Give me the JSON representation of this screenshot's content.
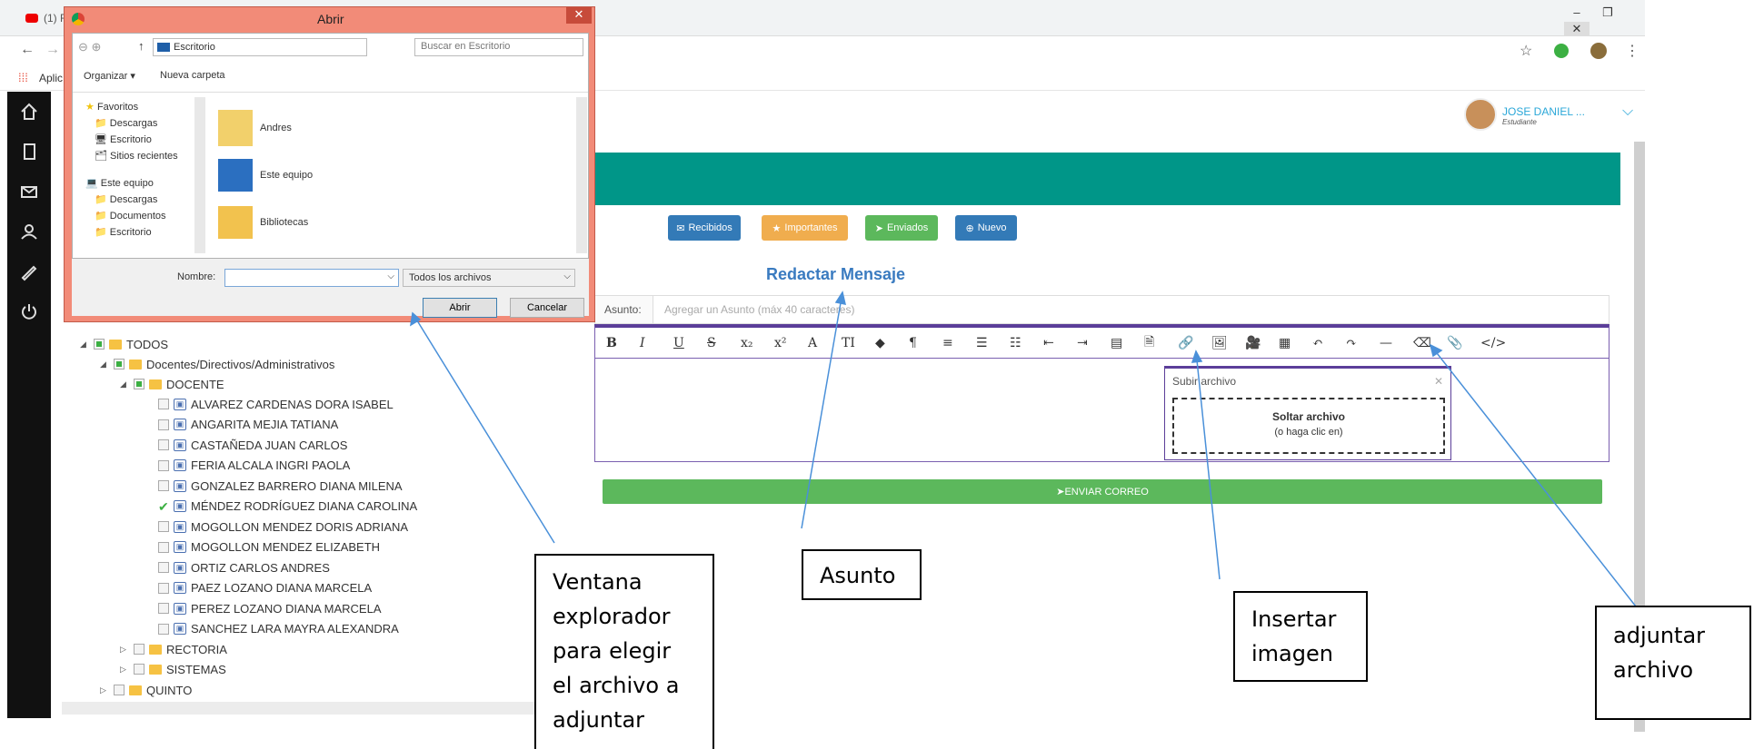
{
  "browser": {
    "tab_title": "(1) F",
    "bookmarks_label": "Aplic",
    "window_buttons": [
      "–",
      "❐",
      "✕"
    ]
  },
  "user": {
    "name": "JOSE DANIEL ...",
    "role": "Estudiante"
  },
  "main": {
    "buttons": {
      "inbox": "Recibidos",
      "important": "Importantes",
      "sent": "Enviados",
      "new": "Nuevo"
    },
    "title": "Redactar Mensaje",
    "subject_label": "Asunto:",
    "subject_placeholder": "Agregar un Asunto (máx 40 caracteres)",
    "toolbar": [
      "B",
      "I",
      "U",
      "S",
      "x₂",
      "x²",
      "A",
      "TI",
      "◆",
      "¶",
      "≡",
      "☰",
      "☷",
      "⇤",
      "⇥",
      "▤",
      "🗎",
      "🔗",
      "🖼",
      "🎥",
      "▦",
      "↶",
      "↷",
      "—",
      "⌫",
      "📎",
      "</>"
    ],
    "upload": {
      "title": "Subir archivo",
      "drop_title": "Soltar archivo",
      "drop_hint": "(o haga clic en)"
    },
    "send_label": "ENVIAR CORREO"
  },
  "tree": {
    "root": "TODOS",
    "group": "Docentes/Directivos/Administrativos",
    "subgroup": "DOCENTE",
    "people": [
      {
        "name": "ALVAREZ CARDENAS DORA ISABEL",
        "checked": false
      },
      {
        "name": "ANGARITA MEJIA TATIANA",
        "checked": false
      },
      {
        "name": "CASTAÑEDA JUAN CARLOS",
        "checked": false
      },
      {
        "name": "FERIA ALCALA INGRI PAOLA",
        "checked": false
      },
      {
        "name": "GONZALEZ BARRERO DIANA MILENA",
        "checked": false
      },
      {
        "name": "MÉNDEZ RODRÍGUEZ DIANA CAROLINA",
        "checked": true
      },
      {
        "name": "MOGOLLON MENDEZ DORIS ADRIANA",
        "checked": false
      },
      {
        "name": "MOGOLLON MENDEZ ELIZABETH",
        "checked": false
      },
      {
        "name": "ORTIZ CARLOS ANDRES",
        "checked": false
      },
      {
        "name": "PAEZ LOZANO DIANA MARCELA",
        "checked": false
      },
      {
        "name": "PEREZ LOZANO DIANA MARCELA",
        "checked": false
      },
      {
        "name": "SANCHEZ LARA MAYRA ALEXANDRA",
        "checked": false
      }
    ],
    "others": [
      "RECTORIA",
      "SISTEMAS"
    ],
    "last": "QUINTO"
  },
  "dialog": {
    "title": "Abrir",
    "path": "Escritorio",
    "search_placeholder": "Buscar en Escritorio",
    "organize": "Organizar ▾",
    "new_folder": "Nueva carpeta",
    "nav": {
      "favorites": "Favoritos",
      "fav_items": [
        "Descargas",
        "Escritorio",
        "Sitios recientes"
      ],
      "this_pc": "Este equipo",
      "pc_items": [
        "Descargas",
        "Documentos",
        "Escritorio"
      ]
    },
    "files": [
      "Andres",
      "Este equipo",
      "Bibliotecas"
    ],
    "name_label": "Nombre:",
    "filter": "Todos los archivos",
    "open": "Abrir",
    "cancel": "Cancelar"
  },
  "callouts": {
    "explorer": "Ventana explorador para elegir el archivo a adjuntar",
    "subject": "Asunto",
    "image": "Insertar imagen",
    "attach": "adjuntar archivo"
  },
  "colors": {
    "banner": "#009688",
    "inbox": "#337ab7",
    "important": "#f0ad4e",
    "sent": "#5cb85c",
    "new": "#337ab7",
    "callout_line": "#4a90d9"
  }
}
